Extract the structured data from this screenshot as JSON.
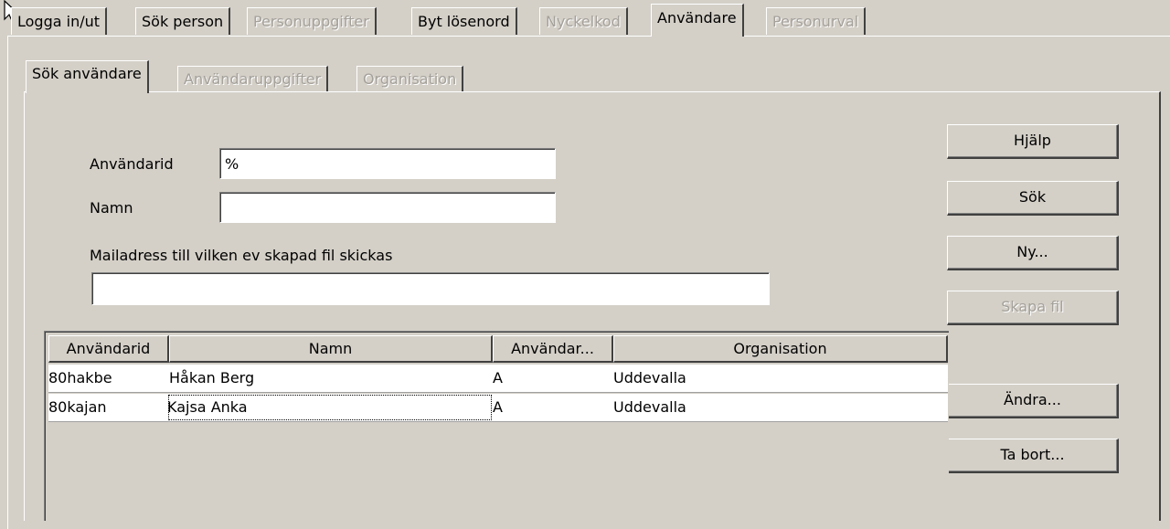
{
  "top_tabs": [
    {
      "label": "Logga in/ut",
      "state": "enabled"
    },
    {
      "label": "Sök person",
      "state": "enabled"
    },
    {
      "label": "Personuppgifter",
      "state": "disabled"
    },
    {
      "label": "Byt lösenord",
      "state": "enabled"
    },
    {
      "label": "Nyckelkod",
      "state": "disabled"
    },
    {
      "label": "Användare",
      "state": "active"
    },
    {
      "label": "Personurval",
      "state": "disabled"
    }
  ],
  "sub_tabs": [
    {
      "label": "Sök användare",
      "state": "active"
    },
    {
      "label": "Användaruppgifter",
      "state": "disabled"
    },
    {
      "label": "Organisation",
      "state": "disabled"
    }
  ],
  "form": {
    "userid_label": "Användarid",
    "userid_value": "%",
    "name_label": "Namn",
    "name_value": "",
    "mail_label": "Mailadress till vilken ev skapad fil skickas",
    "mail_value": ""
  },
  "buttons": {
    "help": "Hjälp",
    "search": "Sök",
    "new": "Ny...",
    "create_file": "Skapa fil",
    "edit": "Ändra...",
    "delete": "Ta bort..."
  },
  "table": {
    "columns": [
      "Användarid",
      "Namn",
      "Användar...",
      "Organisation"
    ],
    "rows": [
      [
        "80hakbe",
        "Håkan Berg",
        "A",
        "Uddevalla"
      ],
      [
        "80kajan",
        "Kajsa Anka",
        "A",
        "Uddevalla"
      ]
    ]
  },
  "colors": {
    "window_bg": "#d4d0c8",
    "disabled_text": "#a4a09a"
  }
}
